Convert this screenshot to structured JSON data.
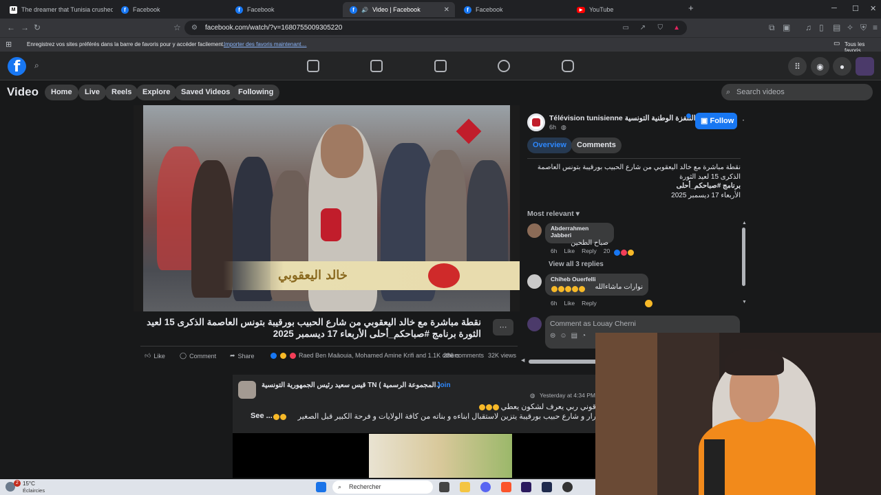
{
  "browser": {
    "tabs": [
      {
        "icon": "m-icon",
        "label": "The dreamer that Tunisia crushed. Th"
      },
      {
        "icon": "facebook-icon",
        "label": "Facebook"
      },
      {
        "icon": "facebook-icon",
        "label": "Facebook"
      },
      {
        "icon": "facebook-icon",
        "label": "Video | Facebook"
      },
      {
        "icon": "facebook-icon",
        "label": "Facebook"
      },
      {
        "icon": "youtube-icon",
        "label": "YouTube"
      }
    ],
    "url": "facebook.com/watch/?v=1680755009305220",
    "bookmarks_prompt": "Enregistrez vos sites préférés dans la barre de favoris pour y accéder facilement.",
    "bookmarks_import": "Importer des favoris maintenant…",
    "all_favorites": "Tous les favoris"
  },
  "fb": {
    "section_title": "Video",
    "nav": [
      "Home",
      "Live",
      "Reels",
      "Explore",
      "Saved Videos",
      "Following"
    ],
    "search_placeholder": "Search videos"
  },
  "video": {
    "lower_third_name": "خالد اليعقوبي",
    "title": "نقطة مباشرة مع خالد اليعقوبي من شارع الحبيب بورقيبة بتونس العاصمة الذكرى 15 لعيد الثورة برنامج #صباحكم_أحلى الأربعاء 17 ديسمبر 2025",
    "like_label": "Like",
    "comment_label": "Comment",
    "share_label": "Share",
    "reactors": "Raed Ben Maâouia, Mohamed Amine Krifi and 1.1K others",
    "comments_count": "286 comments",
    "views": "32K views"
  },
  "page": {
    "name": "Télévision tunisienne التلفزة الوطنية التونسية",
    "time": "6h",
    "follow_label": "Follow",
    "tab_overview": "Overview",
    "tab_comments": "Comments",
    "desc_line1": "نقطة مباشرة مع خالد اليعقوبي من شارع الحبيب بورقيبة بتونس العاصمة",
    "desc_line2": "الذكرى 15 لعيد الثورة",
    "desc_line3": "برنامج #صباحكم_أحلى",
    "desc_line4": "الأربعاء 17 ديسمبر 2025",
    "sort_label": "Most relevant"
  },
  "comments": [
    {
      "author": "Abderrahmen Jabberi",
      "text": "صباح الطحين",
      "time": "6h",
      "like": "Like",
      "reply": "Reply",
      "reactions": "20",
      "replies": "View all 3 replies"
    },
    {
      "author": "Chiheb Ouerfelli",
      "text": "نوارات ماشاءالله",
      "time": "6h",
      "like": "Like",
      "reply": "Reply"
    }
  ],
  "comment_box_placeholder": "Comment as Louay Cherni",
  "post2": {
    "group": "( المجموعة الرسمية ) TN قيس سعيد رئيس الجمهورية التونسية",
    "join": "Join",
    "time": "Yesterday at 4:34 PM",
    "line1": "قوني ربي يعرف لشكون يعطي",
    "line2": "رار و شارع حبيب بورقيبة يتزين لاستقبال ابناءه و بناته من كافة الولايات و فرحة الكبير قبل الصغير",
    "see_more": "See ..."
  },
  "taskbar": {
    "weather_temp": "15°C",
    "weather_desc": "Éclaircies",
    "badge": "2",
    "search": "Rechercher"
  },
  "colors": {
    "fb_blue": "#1877f2",
    "bg": "#18191a",
    "panel": "#242526"
  }
}
